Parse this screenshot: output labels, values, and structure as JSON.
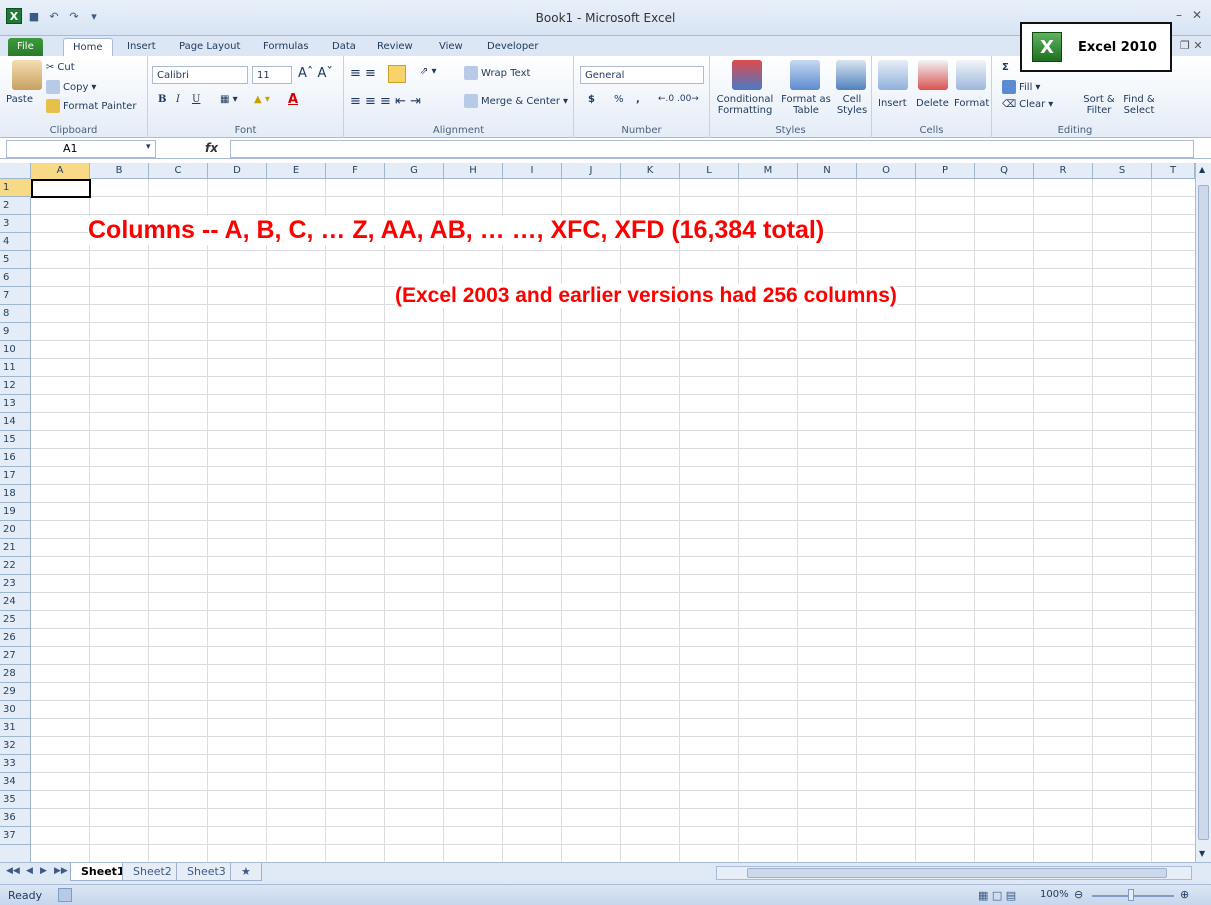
{
  "window": {
    "title": "Book1 - Microsoft Excel"
  },
  "tabs": [
    "File",
    "Home",
    "Insert",
    "Page Layout",
    "Formulas",
    "Data",
    "Review",
    "View",
    "Developer"
  ],
  "ribbon": {
    "clipboard": {
      "paste": "Paste",
      "cut": "Cut",
      "copy": "Copy",
      "format_painter": "Format Painter",
      "label": "Clipboard"
    },
    "font": {
      "name": "Calibri",
      "size": "11",
      "label": "Font",
      "bold": "B",
      "italic": "I",
      "underline": "U"
    },
    "alignment": {
      "wrap": "Wrap Text",
      "merge": "Merge & Center",
      "label": "Alignment"
    },
    "number": {
      "format": "General",
      "currency": "$",
      "percent": "%",
      "comma": ",",
      "label": "Number"
    },
    "styles": {
      "conditional": "Conditional Formatting",
      "format_table": "Format as Table",
      "cell_styles": "Cell Styles",
      "label": "Styles"
    },
    "cells": {
      "insert": "Insert",
      "delete": "Delete",
      "format": "Format",
      "label": "Cells"
    },
    "editing": {
      "sum": "Σ",
      "fill": "Fill",
      "clear": "Clear",
      "sort": "Sort & Filter",
      "find": "Find & Select",
      "label": "Editing"
    }
  },
  "badge": {
    "text": "Excel 2010",
    "icon": "X"
  },
  "formula_bar": {
    "name_box": "A1",
    "fx": "fx",
    "value": ""
  },
  "columns": [
    "A",
    "B",
    "C",
    "D",
    "E",
    "F",
    "G",
    "H",
    "I",
    "J",
    "K",
    "L",
    "M",
    "N",
    "O",
    "P",
    "Q",
    "R",
    "S",
    "T"
  ],
  "rows": [
    "1",
    "2",
    "3",
    "4",
    "5",
    "6",
    "7",
    "8",
    "9",
    "10",
    "11",
    "12",
    "13",
    "14",
    "15",
    "16",
    "17",
    "18",
    "19",
    "20",
    "21",
    "22",
    "23",
    "24",
    "25",
    "26",
    "27",
    "28",
    "29",
    "30",
    "31",
    "32",
    "33",
    "34",
    "35",
    "36",
    "37"
  ],
  "annotations": {
    "line1": "Columns -- A, B, C, … Z, AA, AB, …      …, XFC, XFD (16,384 total)",
    "line2": "(Excel 2003 and earlier versions had 256 columns)"
  },
  "sheets": [
    "Sheet1",
    "Sheet2",
    "Sheet3"
  ],
  "status": {
    "mode": "Ready",
    "zoom": "100%"
  },
  "colors": {
    "annotation": "#ff0000",
    "file_tab": "#2a7a2a"
  }
}
